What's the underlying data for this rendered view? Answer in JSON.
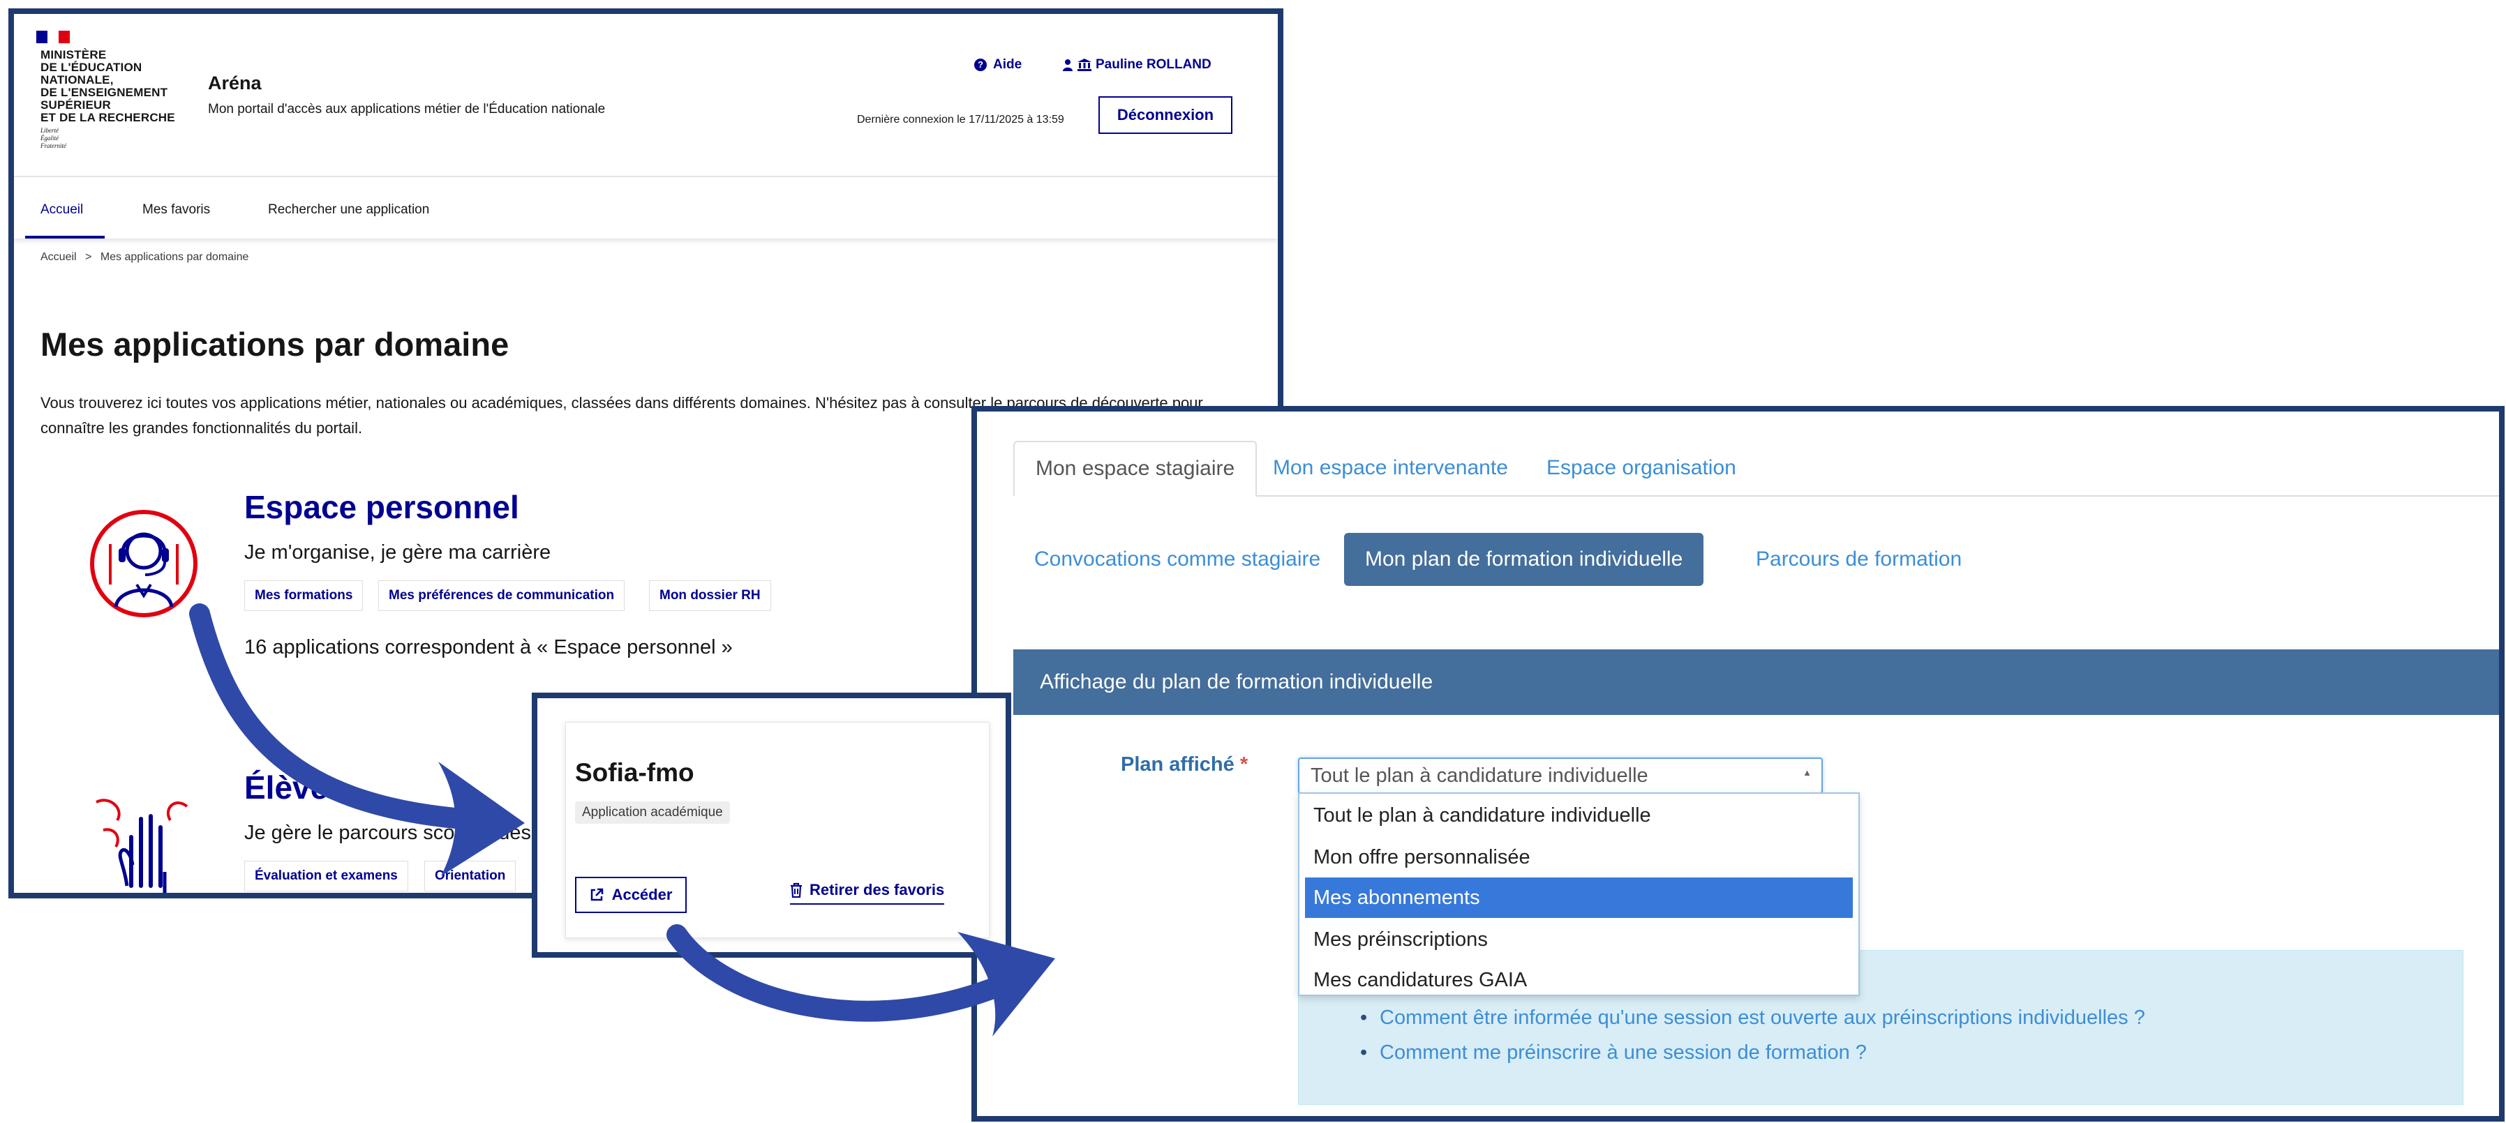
{
  "colors": {
    "frame": "#1e3a6e",
    "arena_blue": "#000091",
    "marianne_red": "#e1000f",
    "arrow_blue": "#2f49a8",
    "sofia_link": "#3b8ed6",
    "sofia_header": "#446e9b",
    "sofia_info_bg": "#d9edf7",
    "dropdown_selected": "#3779db"
  },
  "arena": {
    "ministry": "MINISTÈRE\nDE L'ÉDUCATION\nNATIONALE,\nDE L'ENSEIGNEMENT\nSUPÉRIEUR\nET DE LA RECHERCHE",
    "motto": "Liberté\nÉgalité\nFraternité",
    "app_name": "Aréna",
    "app_tagline": "Mon portail d'accès aux applications métier de l'Éducation nationale",
    "help": "Aide",
    "user": "Pauline ROLLAND",
    "last_login": "Dernière connexion le 17/11/2025 à 13:59",
    "logout": "Déconnexion",
    "nav": [
      "Accueil",
      "Mes favoris",
      "Rechercher une application"
    ],
    "breadcrumb": {
      "home": "Accueil",
      "sep": ">",
      "current": "Mes applications par domaine"
    },
    "page_title": "Mes applications par domaine",
    "intro_before": "Vous trouverez ici toutes vos applications métier, nationales ou académiques, classées dans différents domaines. N'hésitez pas à consulter ",
    "intro_link": "le parcours de découverte",
    "intro_after": " pour connaître les grandes fonctionnalités du portail.",
    "domains": [
      {
        "title": "Espace personnel",
        "subtitle": "Je m'organise, je gère ma carrière",
        "tags": [
          "Mes formations",
          "Mes préférences de communication",
          "Mon dossier RH"
        ],
        "count": "16 applications correspondent à « Espace personnel »",
        "icon": "headset-person-icon"
      },
      {
        "title": "Élèves",
        "subtitle": "Je gère le parcours scolaire des",
        "tags": [
          "Évaluation et examens",
          "Orientation"
        ],
        "icon": "raised-hand-icon"
      }
    ]
  },
  "sofia_card": {
    "title": "Sofia-fmo",
    "badge": "Application académique",
    "access": "Accéder",
    "remove": "Retirer des favoris"
  },
  "plan": {
    "tabs": [
      "Mon espace stagiaire",
      "Mon espace intervenante",
      "Espace organisation"
    ],
    "subtabs": [
      "Convocations comme stagiaire",
      "Mon plan de formation individuelle",
      "Parcours de formation"
    ],
    "section_title": "Affichage du plan de formation individuelle",
    "field_label": "Plan affiché",
    "required_mark": "*",
    "selected_value": "Tout le plan à candidature individuelle",
    "options": [
      "Tout le plan à candidature individuelle",
      "Mon offre personnalisée",
      "Mes abonnements",
      "Mes préinscriptions",
      "Mes candidatures GAIA"
    ],
    "highlighted_option": "Mes abonnements",
    "info_links": [
      "Comment être informée qu'une session est ouverte aux préinscriptions individuelles ?",
      "Comment me préinscrire à une session de formation ?"
    ]
  }
}
